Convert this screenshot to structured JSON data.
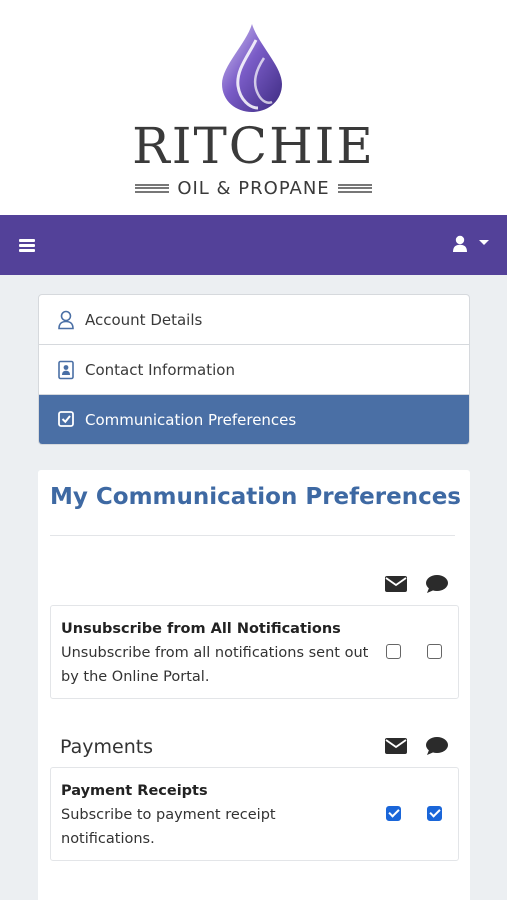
{
  "brand": {
    "name": "RITCHIE",
    "tagline": "OIL & PROPANE",
    "colors": {
      "header": "#534199",
      "accent": "#3e69a3",
      "active_nav": "#4a6fa5",
      "checkbox": "#1a66d9"
    }
  },
  "topbar": {
    "menu_icon": "hamburger-icon",
    "user_icon": "user-icon"
  },
  "nav": {
    "items": [
      {
        "label": "Account Details",
        "icon": "user-outline-icon",
        "active": false
      },
      {
        "label": "Contact Information",
        "icon": "contact-card-icon",
        "active": false
      },
      {
        "label": "Communication Preferences",
        "icon": "checkbox-square-icon",
        "active": true
      }
    ]
  },
  "preferences": {
    "title": "My Communication Preferences",
    "channel_icons": [
      "envelope-icon",
      "chat-bubble-icon"
    ],
    "global": {
      "title": "Unsubscribe from All Notifications",
      "description": "Unsubscribe from all notifications sent out by the Online Portal.",
      "email": false,
      "sms": false
    },
    "sections": [
      {
        "name": "Payments",
        "items": [
          {
            "title": "Payment Receipts",
            "description": "Subscribe to payment receipt notifications.",
            "email": true,
            "sms": true
          }
        ]
      }
    ]
  }
}
